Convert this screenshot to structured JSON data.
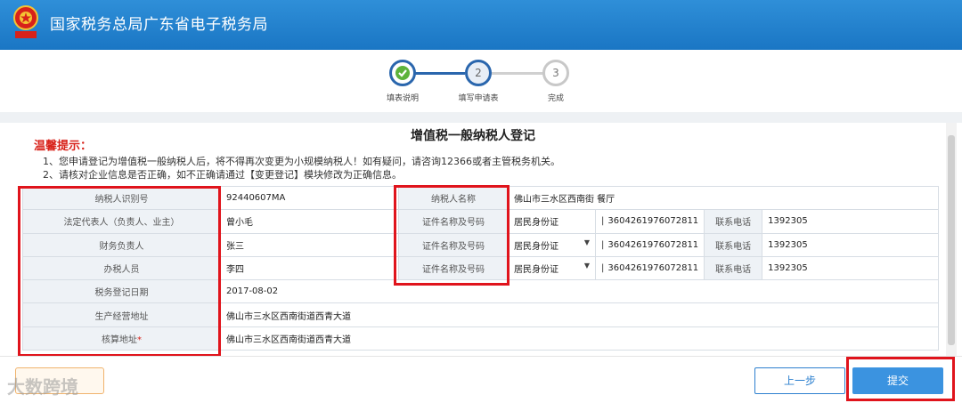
{
  "header": {
    "title": "国家税务总局广东省电子税务局"
  },
  "steps": [
    {
      "label": "填表说明",
      "number": "1",
      "status": "done"
    },
    {
      "label": "填写申请表",
      "number": "2",
      "status": "active"
    },
    {
      "label": "完成",
      "number": "3",
      "status": "pending"
    }
  ],
  "form": {
    "title": "增值税一般纳税人登记",
    "tip_heading": "温馨提示：",
    "tips": [
      "1、您申请登记为增值税一般纳税人后，将不得再次变更为小规模纳税人！如有疑问，请咨询12366或者主管税务机关。",
      "2、请核对企业信息是否正确，如不正确请通过【变更登记】模块修改为正确信息。"
    ]
  },
  "rows": [
    {
      "label": "纳税人识别号",
      "value": "92440607MA",
      "label2": "纳税人名称",
      "value2": "佛山市三水区西南街 餐厅"
    },
    {
      "label": "法定代表人（负责人、业主）",
      "value": "曾小毛",
      "label2": "证件名称及号码",
      "id_type": "居民身份证",
      "id_number": "3604261976072811",
      "phone_label": "联系电话",
      "phone": "1392305"
    },
    {
      "label": "财务负责人",
      "value": "张三",
      "label2": "证件名称及号码",
      "id_type": "居民身份证",
      "id_number": "3604261976072811",
      "phone_label": "联系电话",
      "phone": "1392305"
    },
    {
      "label": "办税人员",
      "value": "李四",
      "label2": "证件名称及号码",
      "id_type": "居民身份证",
      "id_number": "3604261976072811",
      "phone_label": "联系电话",
      "phone": "1392305"
    },
    {
      "label": "税务登记日期",
      "value": "2017-08-02"
    },
    {
      "label": "生产经营地址",
      "value": "佛山市三水区西南街道西青大道"
    },
    {
      "label": "核算地址",
      "required_mark": "*",
      "value": "佛山市三水区西南街道西青大道"
    }
  ],
  "footer": {
    "watermark": "大数跨境",
    "prev_label": "上一步",
    "submit_label": "提交"
  },
  "colors": {
    "header_blue": "#1a76c4",
    "highlight_red": "#e0141c",
    "tip_red": "#d8221a",
    "step_blue": "#2a66ad"
  }
}
